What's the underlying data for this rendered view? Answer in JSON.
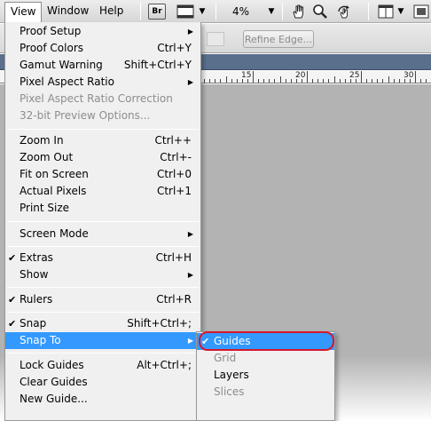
{
  "menubar": {
    "view": "View",
    "window": "Window",
    "help": "Help",
    "bridge_label": "Br",
    "zoom_value": "4%"
  },
  "options": {
    "refine_edge": "Refine Edge..."
  },
  "ruler": {
    "labels": [
      "15",
      "20",
      "25",
      "30"
    ]
  },
  "view_menu": {
    "items": [
      {
        "label": "Proof Setup",
        "submenu": true
      },
      {
        "label": "Proof Colors",
        "shortcut": "Ctrl+Y"
      },
      {
        "label": "Gamut Warning",
        "shortcut": "Shift+Ctrl+Y"
      },
      {
        "label": "Pixel Aspect Ratio",
        "submenu": true
      },
      {
        "label": "Pixel Aspect Ratio Correction",
        "disabled": true
      },
      {
        "label": "32-bit Preview Options...",
        "disabled": true
      },
      {
        "label": "Zoom In",
        "shortcut": "Ctrl++"
      },
      {
        "label": "Zoom Out",
        "shortcut": "Ctrl+-"
      },
      {
        "label": "Fit on Screen",
        "shortcut": "Ctrl+0"
      },
      {
        "label": "Actual Pixels",
        "shortcut": "Ctrl+1"
      },
      {
        "label": "Print Size"
      },
      {
        "label": "Screen Mode",
        "submenu": true
      },
      {
        "label": "Extras",
        "shortcut": "Ctrl+H",
        "checked": true
      },
      {
        "label": "Show",
        "submenu": true
      },
      {
        "label": "Rulers",
        "shortcut": "Ctrl+R",
        "checked": true
      },
      {
        "label": "Snap",
        "shortcut": "Shift+Ctrl+;",
        "checked": true
      },
      {
        "label": "Snap To",
        "submenu": true,
        "highlighted": true
      },
      {
        "label": "Lock Guides",
        "shortcut": "Alt+Ctrl+;"
      },
      {
        "label": "Clear Guides"
      },
      {
        "label": "New Guide..."
      }
    ]
  },
  "snap_to_menu": {
    "items": [
      {
        "label": "Guides",
        "checked": true,
        "highlighted": true
      },
      {
        "label": "Grid",
        "disabled": true
      },
      {
        "label": "Layers"
      },
      {
        "label": "Slices",
        "disabled": true
      }
    ]
  },
  "colors": {
    "highlight": "#3399ff",
    "callout_ring": "#d7182a"
  }
}
